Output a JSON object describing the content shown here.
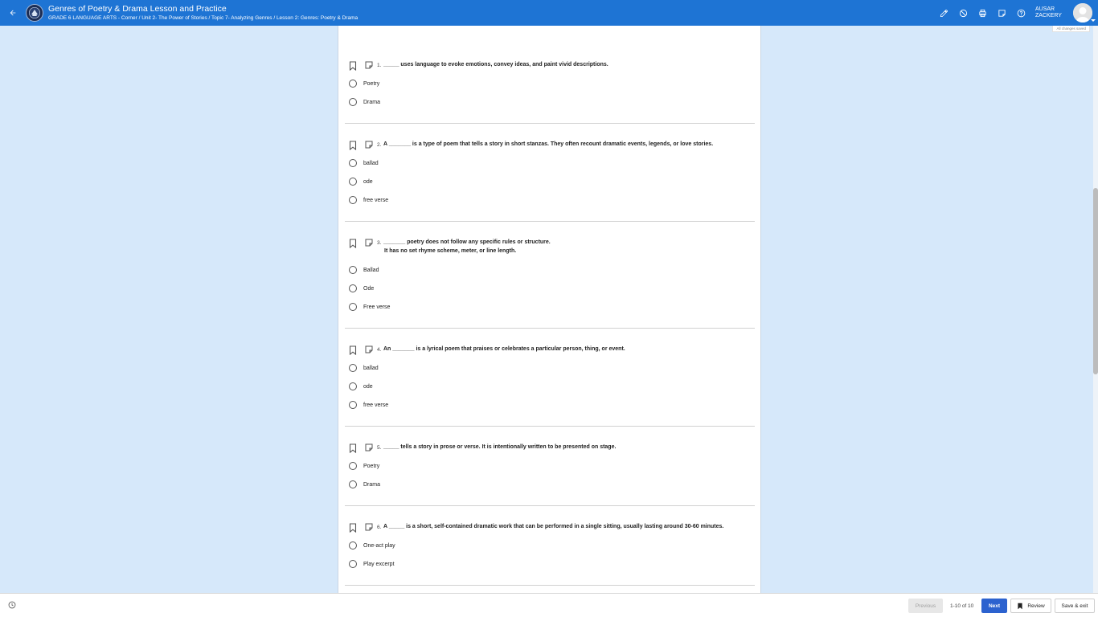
{
  "header": {
    "title": "Genres of Poetry & Drama Lesson and Practice",
    "breadcrumb": "GRADE 6 LANGUAGE ARTS - Corner / Unit 2- The Power of Stories / Topic 7- Analyzing Genres / Lesson 2: Genres: Poetry & Drama",
    "user_first": "AUSAR",
    "user_last": "ZACKERY",
    "save_status": "All changes saved",
    "tools": [
      "pencil-icon",
      "eliminator-icon",
      "print-icon",
      "notes-icon",
      "help-icon"
    ]
  },
  "questions": [
    {
      "number": "1.",
      "text": "_____ uses language to evoke emotions, convey ideas, and paint vivid descriptions.",
      "options": [
        "Poetry",
        "Drama"
      ]
    },
    {
      "number": "2.",
      "text": "A _______ is a type of poem that tells a story in short stanzas. They often recount dramatic events, legends, or love stories.",
      "options": [
        "ballad",
        "ode",
        "free verse"
      ]
    },
    {
      "number": "3.",
      "text": "_______  poetry does not follow any specific rules or structure.",
      "text_line2": "It has no set rhyme scheme, meter, or line length.",
      "options": [
        "Ballad",
        "Ode",
        "Free verse"
      ]
    },
    {
      "number": "4.",
      "text": "An _______ is a lyrical poem that praises or celebrates a particular person, thing, or event.",
      "options": [
        "ballad",
        "ode",
        "free verse"
      ]
    },
    {
      "number": "5.",
      "text": "_____ tells a story in prose or verse. It is intentionally written to be presented on stage.",
      "options": [
        "Poetry",
        "Drama"
      ]
    },
    {
      "number": "6.",
      "text": "A _____ is a short, self-contained dramatic work that can be performed in a single sitting, usually lasting around 30-60 minutes.",
      "options": [
        "One-act play",
        "Play excerpt"
      ]
    }
  ],
  "footer": {
    "previous": "Previous",
    "pager": "1-10 of 10",
    "next": "Next",
    "review": "Review",
    "save_exit": "Save & exit"
  },
  "colors": {
    "header": "#1e74d4",
    "background": "#d6e8fa",
    "next_button": "#2c62cf"
  }
}
